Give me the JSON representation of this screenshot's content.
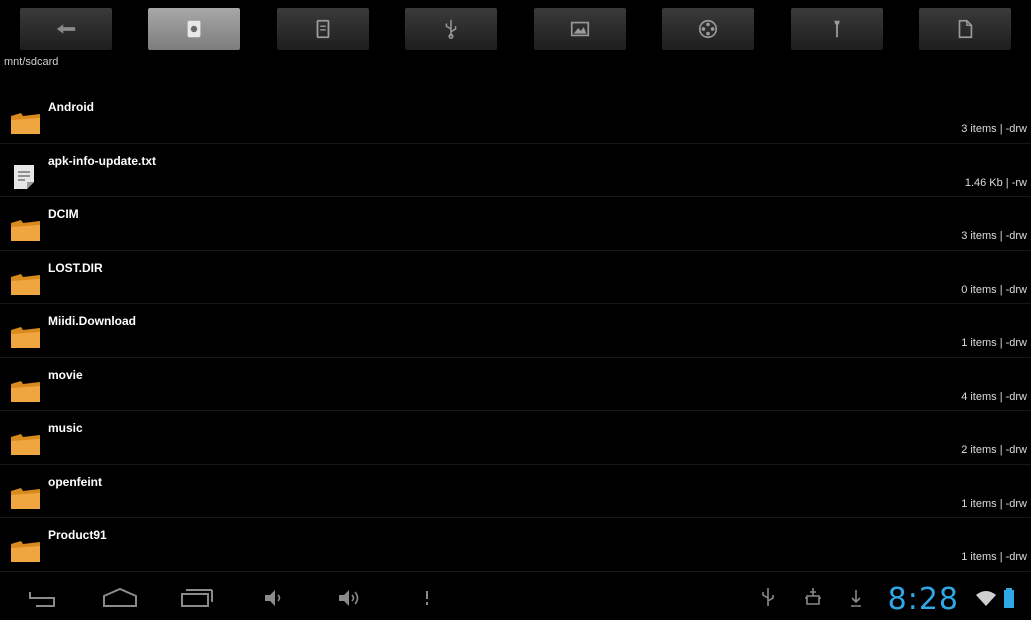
{
  "path": "mnt/sdcard",
  "tabs": [
    {
      "icon": "back-arrow-icon",
      "active": false
    },
    {
      "icon": "sdcard-icon",
      "active": true
    },
    {
      "icon": "internal-storage-icon",
      "active": false
    },
    {
      "icon": "usb-icon",
      "active": false
    },
    {
      "icon": "image-icon",
      "active": false
    },
    {
      "icon": "video-reel-icon",
      "active": false
    },
    {
      "icon": "tools-icon",
      "active": false
    },
    {
      "icon": "document-icon",
      "active": false
    }
  ],
  "files": [
    {
      "name": "Android",
      "meta": "3 items | -drw",
      "type": "folder"
    },
    {
      "name": "apk-info-update.txt",
      "meta": "1.46 Kb | -rw",
      "type": "file"
    },
    {
      "name": "DCIM",
      "meta": "3 items | -drw",
      "type": "folder"
    },
    {
      "name": "LOST.DIR",
      "meta": "0 items | -drw",
      "type": "folder"
    },
    {
      "name": "Miidi.Download",
      "meta": "1 items | -drw",
      "type": "folder"
    },
    {
      "name": "movie",
      "meta": "4 items | -drw",
      "type": "folder"
    },
    {
      "name": "music",
      "meta": "2 items | -drw",
      "type": "folder"
    },
    {
      "name": "openfeint",
      "meta": "1 items | -drw",
      "type": "folder"
    },
    {
      "name": "Product91",
      "meta": "1 items | -drw",
      "type": "folder"
    }
  ],
  "status": {
    "time": "8:28"
  },
  "colors": {
    "folder": "#d98a1c",
    "clock": "#2fa8e8",
    "active_tab": "#9a9a9a"
  }
}
